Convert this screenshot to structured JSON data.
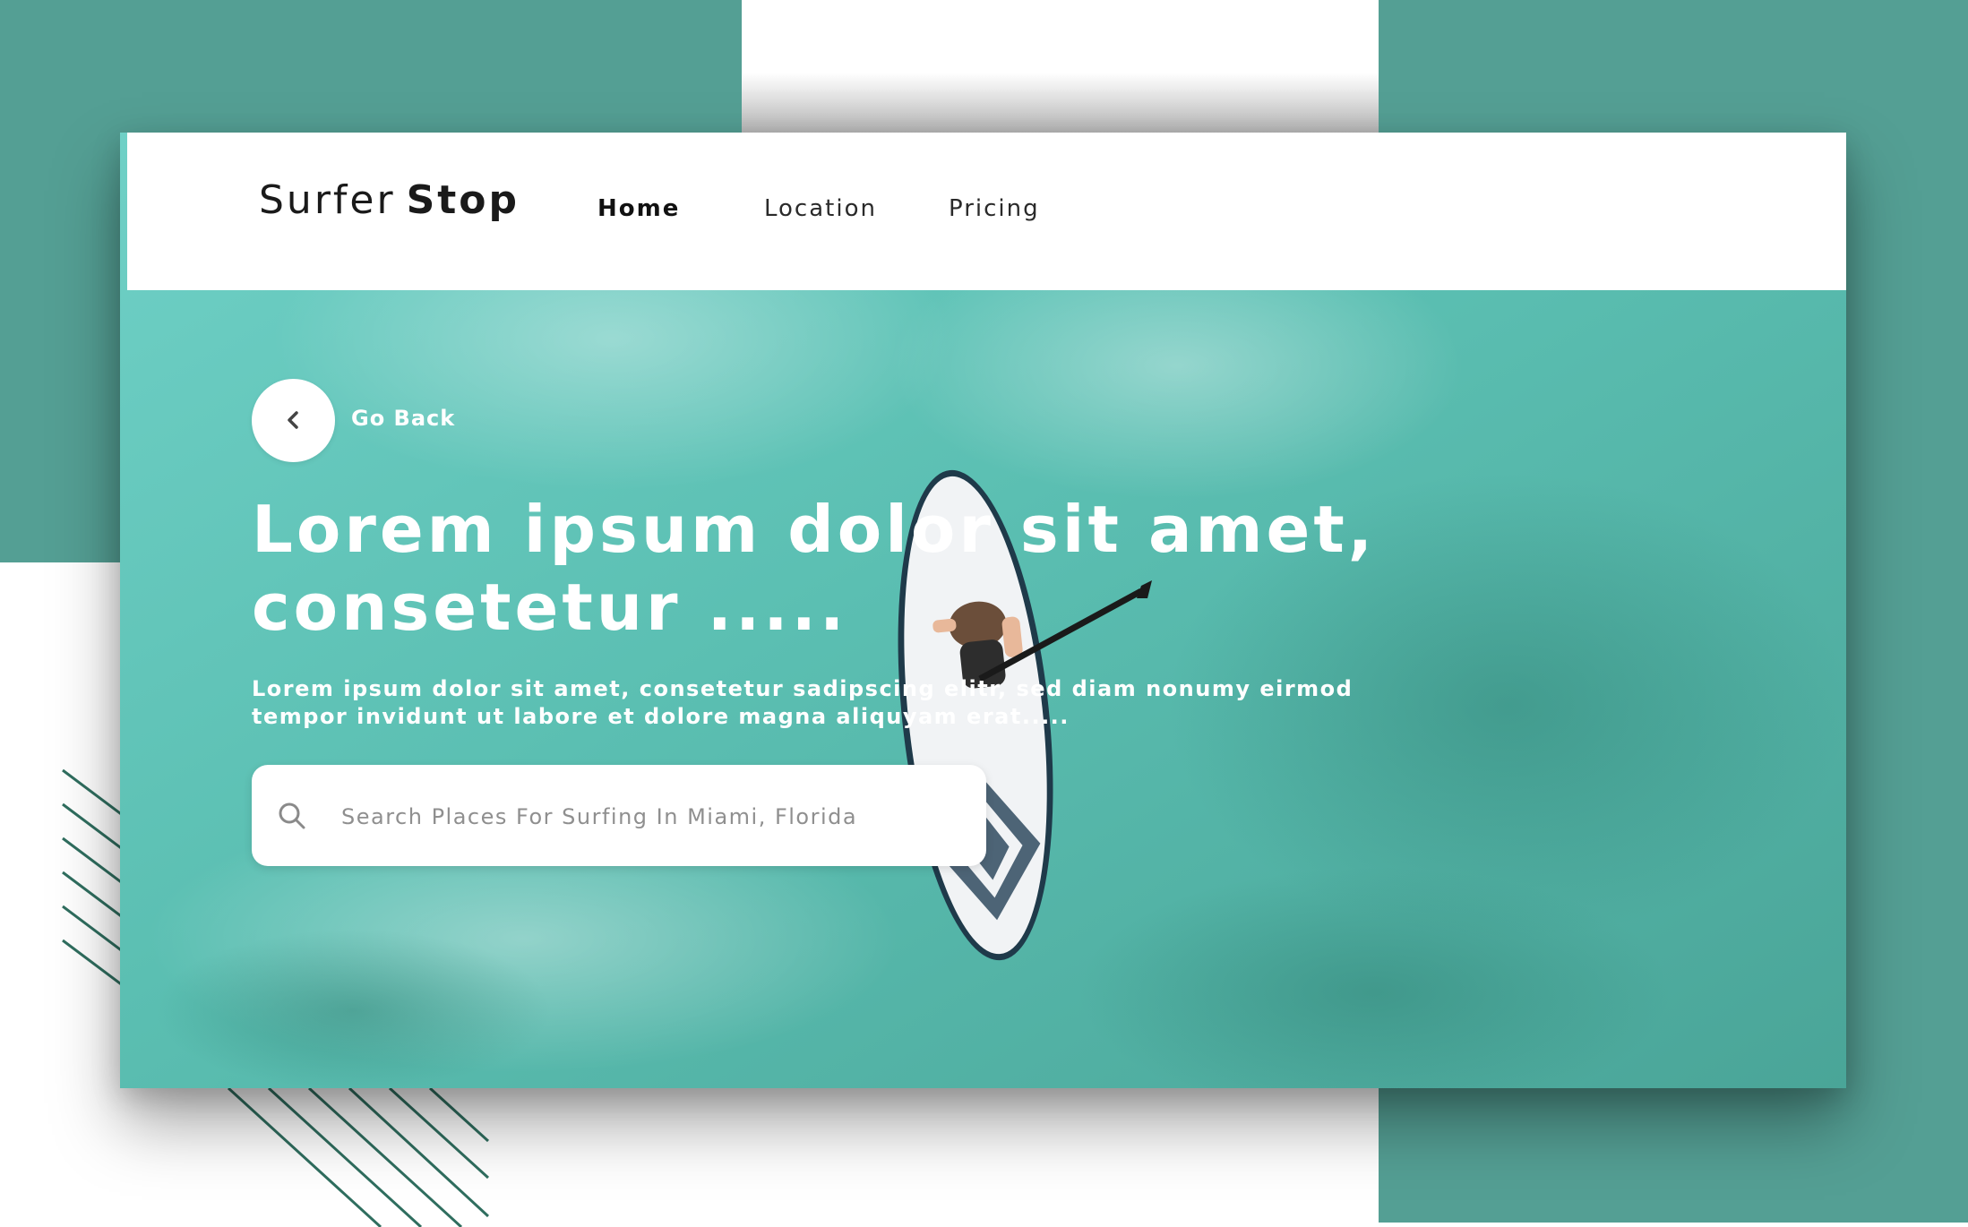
{
  "brand": {
    "name_light": "Surfer",
    "name_bold": "Stop"
  },
  "nav": {
    "items": [
      {
        "label": "Home",
        "active": true
      },
      {
        "label": "Location",
        "active": false
      },
      {
        "label": "Pricing",
        "active": false
      }
    ]
  },
  "hero": {
    "back_label": "Go Back",
    "title": "Lorem ipsum dolor sit amet, consetetur .....",
    "subtitle": "Lorem ipsum dolor sit amet, consetetur sadipscing elitr, sed diam nonumy eirmod tempor invidunt ut labore et dolore magna aliquyam erat.....",
    "search_placeholder": "Search Places For Surfing In Miami, Florida"
  },
  "colors": {
    "accent_teal": "#549f94",
    "stripe_green": "#2f6e5f",
    "water": "#5fc0b4",
    "header_bg": "#ffffff"
  },
  "icons": {
    "back": "chevron-left-icon",
    "search": "search-icon"
  }
}
